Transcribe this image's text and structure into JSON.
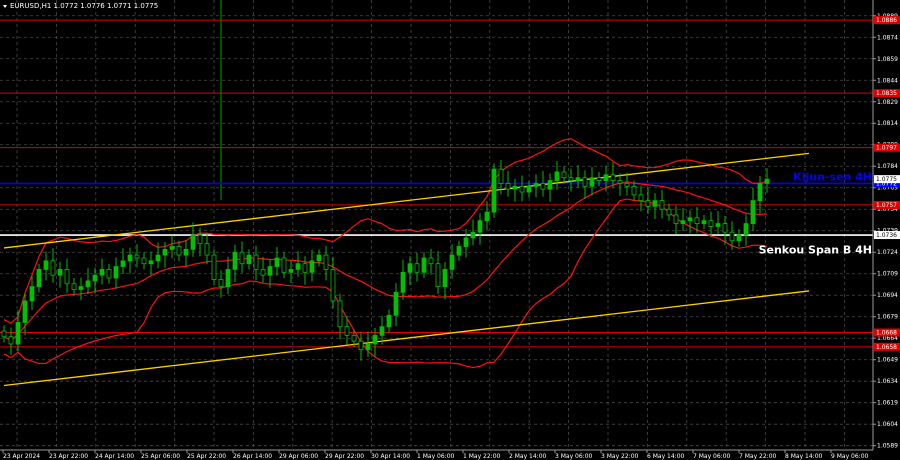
{
  "window": {
    "symbol_title": "EURUSD,H1  1.0772 1.0776 1.0771 1.0775",
    "triangle_icon": "triangle-down-icon"
  },
  "colors": {
    "background": "#000000",
    "grid": "#4a4a4a",
    "candle": "#00c000",
    "level_red": "#e00000",
    "kijun_blue": "#0000ff",
    "senkou_white": "#ffffff",
    "channel_yellow": "#ffd000",
    "bollinger_red": "#ff1010",
    "vertical_green": "#00a000"
  },
  "chart_data": {
    "type": "candlestick",
    "y_range": [
      1.0586,
      1.09
    ],
    "y_ticks": [
      "1.0889",
      "1.0874",
      "1.0859",
      "1.0844",
      "1.0829",
      "1.0814",
      "1.0799",
      "1.0784",
      "1.0769",
      "1.0754",
      "1.0739",
      "1.0724",
      "1.0709",
      "1.0694",
      "1.0679",
      "1.0664",
      "1.0649",
      "1.0634",
      "1.0619",
      "1.0604",
      "1.0589"
    ],
    "x_ticks": [
      "23 Apr 2024",
      "23 Apr 22:00",
      "24 Apr 14:00",
      "25 Apr 06:00",
      "25 Apr 22:00",
      "26 Apr 14:00",
      "29 Apr 06:00",
      "29 Apr 22:00",
      "30 Apr 14:00",
      "1 May 06:00",
      "1 May 22:00",
      "2 May 14:00",
      "3 May 06:00",
      "3 May 22:00",
      "6 May 14:00",
      "7 May 06:00",
      "7 May 22:00",
      "8 May 14:00",
      "9 May 06:00"
    ],
    "horizontal_levels": [
      {
        "price": 1.0886,
        "kind": "red",
        "tag": "1.0886"
      },
      {
        "price": 1.0835,
        "kind": "red",
        "tag": "1.0835"
      },
      {
        "price": 1.0797,
        "kind": "red",
        "tag": "1.0797"
      },
      {
        "price": 1.0772,
        "kind": "blue",
        "tag": "1.0772"
      },
      {
        "price": 1.0757,
        "kind": "red",
        "tag": "1.0757"
      },
      {
        "price": 1.0736,
        "kind": "white",
        "tag": "1.0736"
      },
      {
        "price": 1.0668,
        "kind": "red",
        "tag": "1.0668"
      },
      {
        "price": 1.0658,
        "kind": "red",
        "tag": "1.0658"
      }
    ],
    "price_tag_current": "1.0775",
    "annotations": [
      {
        "label": "Kijun-sen 4H",
        "price": 1.0777,
        "color": "#0000ff"
      },
      {
        "label": "Senkou Span B 4H",
        "price": 1.0726,
        "color": "#ffffff"
      }
    ],
    "channel_lines": [
      {
        "from": [
          0,
          1.0727
        ],
        "to": [
          115,
          1.0793
        ]
      },
      {
        "from": [
          0,
          1.0631
        ],
        "to": [
          115,
          1.0697
        ]
      }
    ],
    "vertical_marker_bar": 31,
    "closes": [
      1.0665,
      1.066,
      1.0675,
      1.069,
      1.07,
      1.0712,
      1.0718,
      1.0708,
      1.0712,
      1.0702,
      1.0698,
      1.07,
      1.0704,
      1.0708,
      1.0712,
      1.0706,
      1.0714,
      1.0718,
      1.0722,
      1.072,
      1.0716,
      1.0718,
      1.0722,
      1.0726,
      1.0728,
      1.0722,
      1.0726,
      1.0736,
      1.073,
      1.0722,
      1.0705,
      1.07,
      1.0712,
      1.0724,
      1.0716,
      1.0722,
      1.0712,
      1.0708,
      1.0714,
      1.072,
      1.071,
      1.0712,
      1.0716,
      1.071,
      1.0718,
      1.0722,
      1.0712,
      1.069,
      1.0672,
      1.0666,
      1.0662,
      1.0656,
      1.066,
      1.0666,
      1.0672,
      1.068,
      1.0696,
      1.071,
      1.0716,
      1.071,
      1.072,
      1.0716,
      1.07,
      1.0712,
      1.0722,
      1.0728,
      1.0734,
      1.0738,
      1.0746,
      1.0752,
      1.0782,
      1.0772,
      1.0768,
      1.077,
      1.0766,
      1.077,
      1.0772,
      1.0768,
      1.0774,
      1.078,
      1.0776,
      1.0774,
      1.0776,
      1.077,
      1.0776,
      1.0774,
      1.0778,
      1.0774,
      1.0772,
      1.077,
      1.0764,
      1.076,
      1.0756,
      1.076,
      1.0754,
      1.075,
      1.0744,
      1.0746,
      1.0748,
      1.0744,
      1.0746,
      1.0742,
      1.0744,
      1.0738,
      1.0732,
      1.0736,
      1.0744,
      1.076,
      1.0772,
      1.0775
    ]
  }
}
